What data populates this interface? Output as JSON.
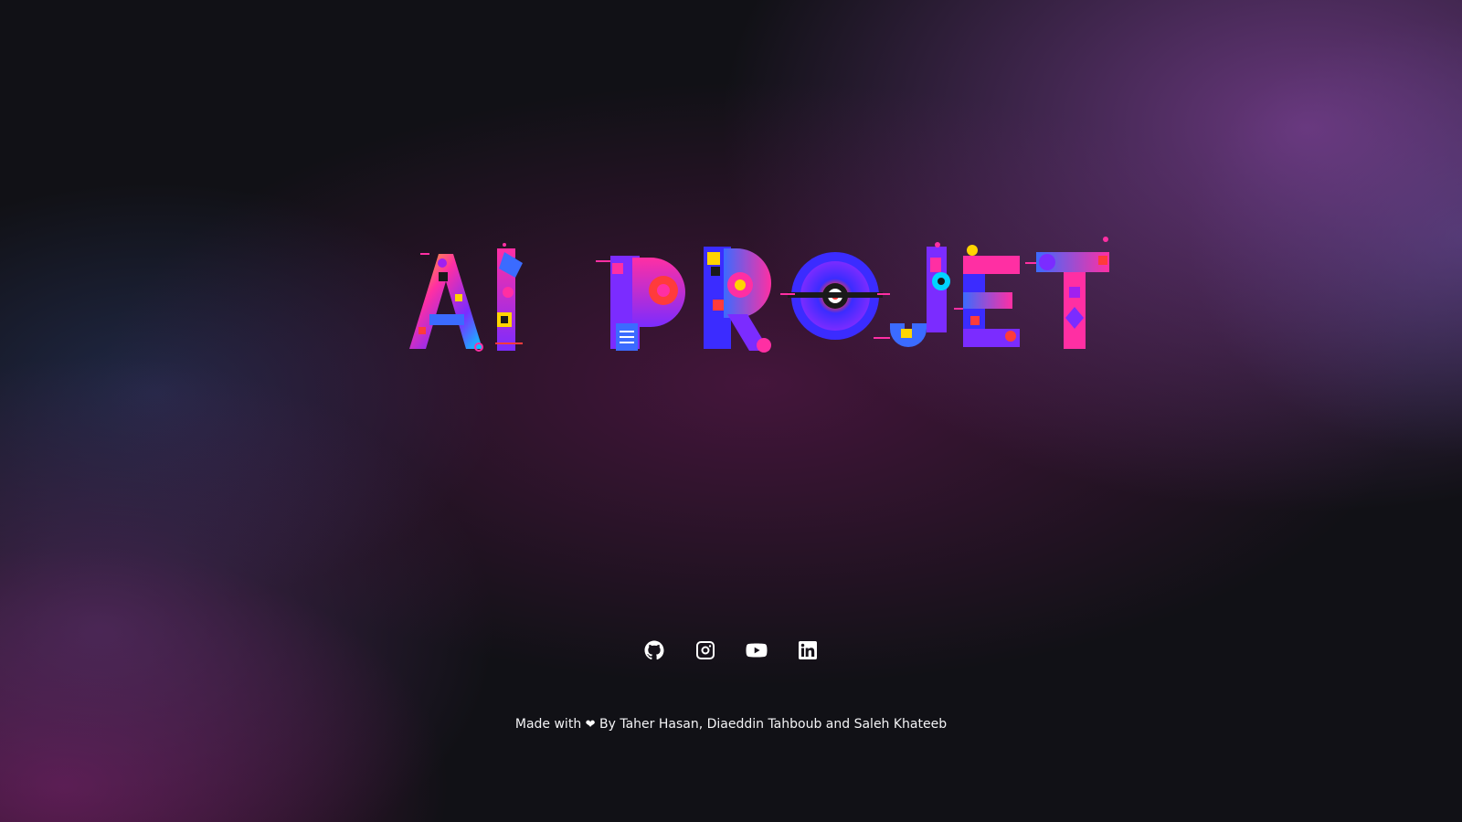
{
  "hero": {
    "title_text": "AI PROJET",
    "logo_colors": [
      "#ff2fa3",
      "#7b2cff",
      "#3b6bff",
      "#00d4ff",
      "#ffd400",
      "#ff3b3b",
      "#a020f0",
      "#1a1a1a"
    ]
  },
  "socials": [
    {
      "name": "github-icon",
      "label": "GitHub"
    },
    {
      "name": "instagram-icon",
      "label": "Instagram"
    },
    {
      "name": "youtube-icon",
      "label": "YouTube"
    },
    {
      "name": "linkedin-icon",
      "label": "LinkedIn"
    }
  ],
  "footer": {
    "made_with": "Made with",
    "heart": "❤",
    "credits": "By Taher Hasan, Diaeddin Tahboub and Saleh Khateeb"
  }
}
